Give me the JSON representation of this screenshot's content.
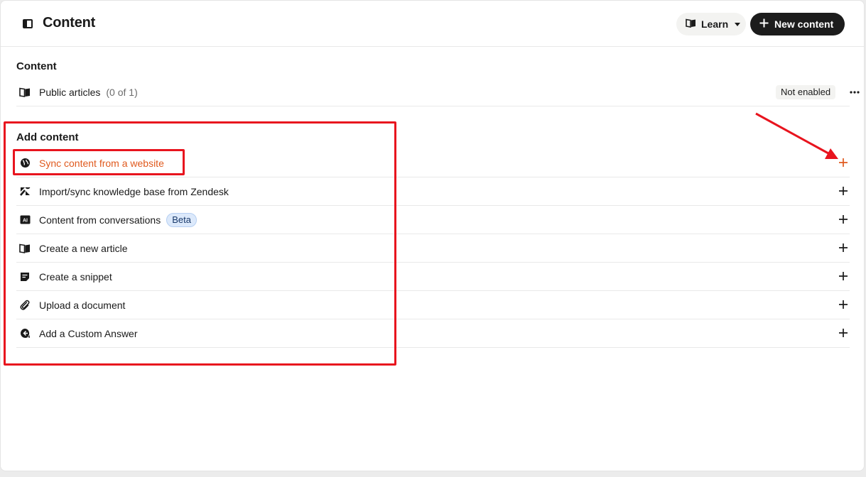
{
  "header": {
    "title": "Content",
    "learn_label": "Learn",
    "new_content_label": "New content"
  },
  "content_section": {
    "title": "Content",
    "public_articles": {
      "label": "Public articles",
      "count": "(0 of 1)",
      "status": "Not enabled"
    }
  },
  "add_content": {
    "title": "Add content",
    "items": [
      {
        "label": "Sync content from a website",
        "icon": "globe-icon"
      },
      {
        "label": "Import/sync knowledge base from Zendesk",
        "icon": "zendesk-icon"
      },
      {
        "label": "Content from conversations",
        "icon": "ai-icon",
        "badge": "Beta"
      },
      {
        "label": "Create a new article",
        "icon": "book-icon"
      },
      {
        "label": "Create a snippet",
        "icon": "snippet-icon"
      },
      {
        "label": "Upload a document",
        "icon": "paperclip-icon"
      },
      {
        "label": "Add a Custom Answer",
        "icon": "custom-answer-icon"
      }
    ]
  },
  "colors": {
    "accent": "#e05a1e",
    "annotation": "#e8141e",
    "primary_button": "#1c1c1c"
  }
}
